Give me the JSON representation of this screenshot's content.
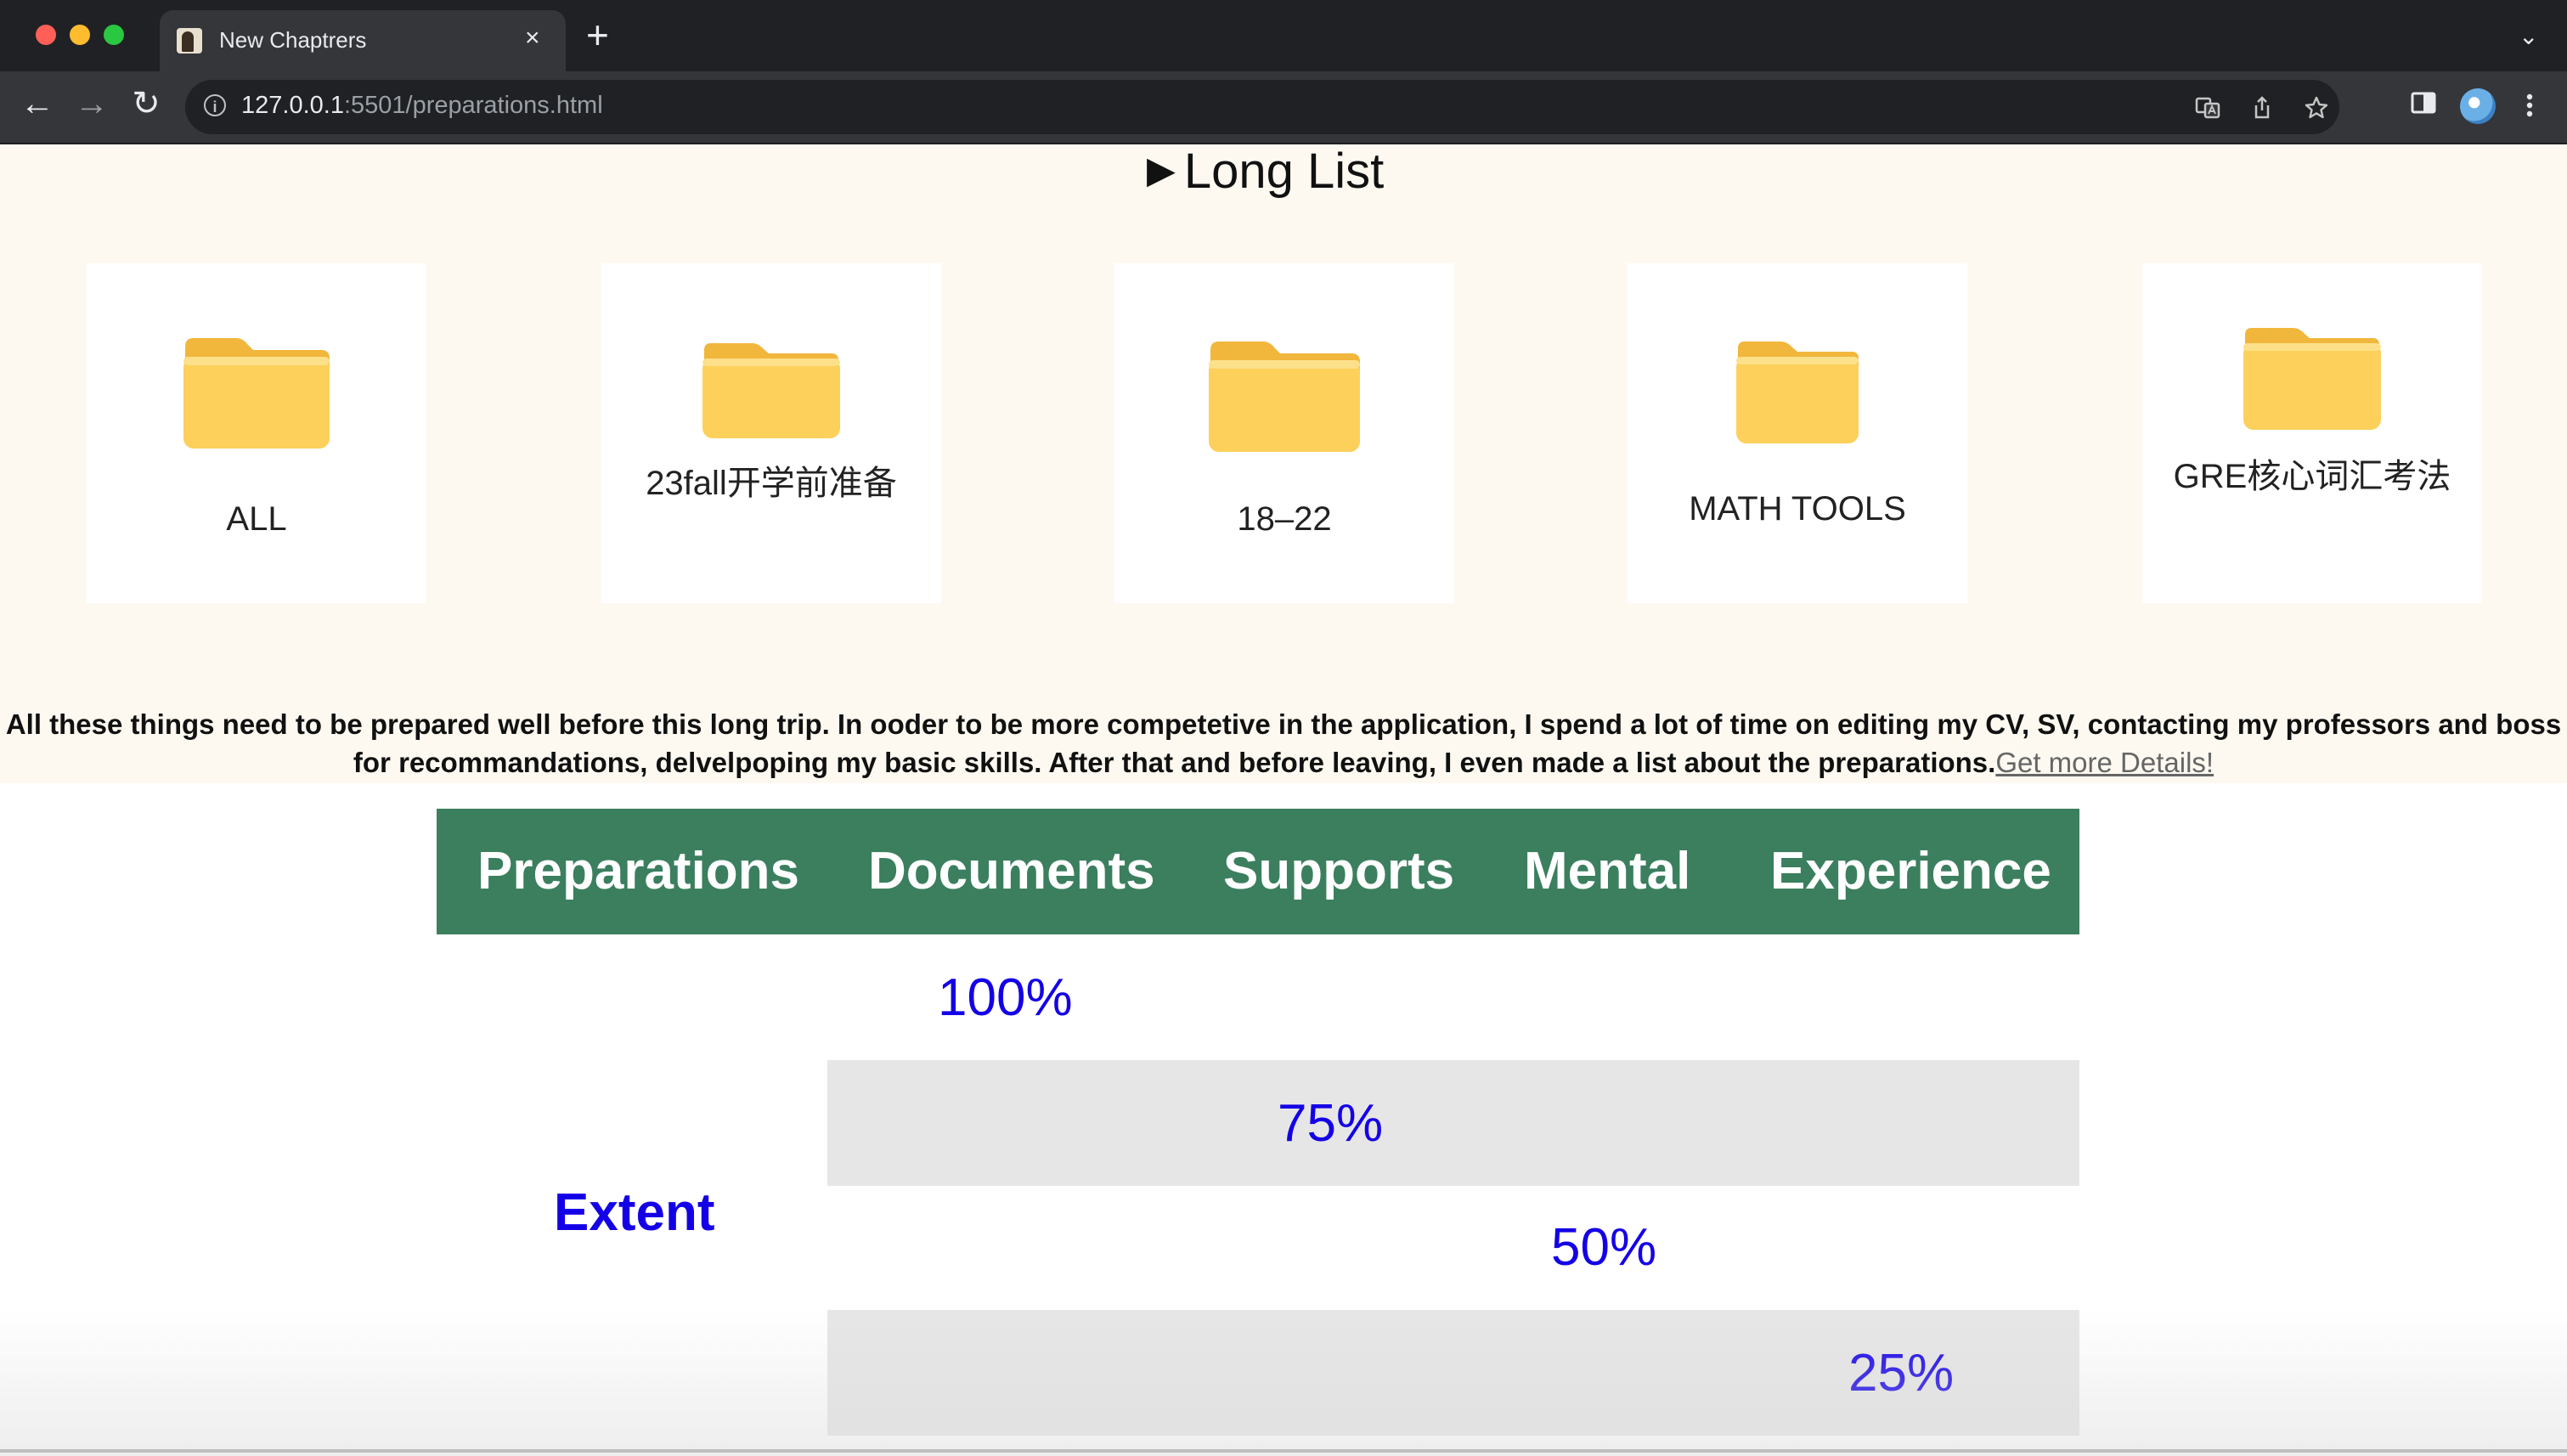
{
  "browser": {
    "tab_title": "New Chaptrers",
    "tab_close": "×",
    "new_tab": "+",
    "tab_menu": "⌄",
    "url_host": "127.0.0.1",
    "url_rest": ":5501/preparations.html",
    "nav": {
      "back": "←",
      "forward": "→",
      "reload": "↻"
    },
    "icons": [
      "info-icon",
      "translate-icon",
      "share-icon",
      "bookmark-star-icon",
      "side-panel-icon",
      "profile-avatar-icon",
      "more-menu-icon"
    ]
  },
  "summary": {
    "marker": "▶",
    "label": "Long List"
  },
  "folders": [
    {
      "label": "ALL"
    },
    {
      "label": "23fall开学前准备"
    },
    {
      "label": "18–22"
    },
    {
      "label": "MATH TOOLS"
    },
    {
      "label": "GRE核心词汇考法"
    }
  ],
  "description": {
    "text": "All these things need to be prepared well before this long trip. In ooder to be more competetive in the application, I spend a lot of time on editing my CV, SV, contacting my professors and boss for recommandations, delvelpoping my basic skills. After that and before leaving, I even made a list about the preparations.",
    "link": "Get more Details!"
  },
  "table": {
    "headers": [
      "Preparations",
      "Documents",
      "Supports",
      "Mental",
      "Experience"
    ],
    "row_label": "Extent",
    "rows": [
      {
        "column": "Documents",
        "value": "100%"
      },
      {
        "column": "Supports",
        "value": "75%"
      },
      {
        "column": "Mental",
        "value": "50%"
      },
      {
        "column": "Experience",
        "value": "25%"
      }
    ]
  },
  "colors": {
    "header_green": "#3b7f5f",
    "value_blue": "#1400e6",
    "page_cream": "#fdf9f1",
    "row_gray": "#e6e6e6",
    "folder_yellow": "#fcd05b"
  }
}
